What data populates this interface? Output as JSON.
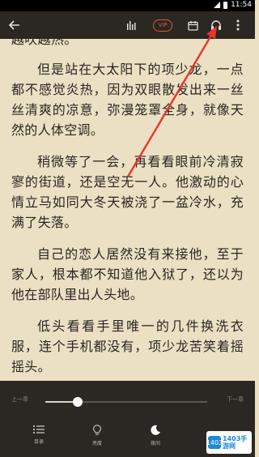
{
  "statusbar": {
    "time": "11:54"
  },
  "toolbar": {
    "back_icon": "arrow-left-icon",
    "chart_icon": "bars-chart-icon",
    "badge_label": "VIP",
    "calendar_icon": "calendar-icon",
    "headphones_icon": "headphones-icon",
    "more_icon": "more-vertical-icon"
  },
  "content": {
    "partial_line": "越吹越热。",
    "paragraphs": [
      "但是站在大太阳下的项少龙，一点都不感觉炎热，因为双眼散发出来一丝丝清爽的凉意，弥漫笼罩全身，就像天然的人体空调。",
      "稍微等了一会，再看看眼前冷清寂寥的街道，还是空无一人。他激动的心情立马如同大冬天被浇了一盆冷水，充满了失落。",
      "自己的恋人居然没有来接他，至于家人，根本都不知道他入狱了，还以为他在部队里出人头地。",
      "低头看看手里唯一的几件换洗衣服，连个手机都没有，项少龙苦笑着摇摇头。"
    ]
  },
  "reader": {
    "prev_chapter": "上一章",
    "next_chapter": "下一章",
    "progress": 0.2
  },
  "actions": {
    "catalog": "目录",
    "light": "亮度",
    "night": "夜间"
  },
  "watermark": {
    "logo_text": "1403",
    "text": "1403手游网"
  },
  "colors": {
    "paper": "#ebe0c4",
    "toolbar": "#2b2723",
    "accent": "#d45a3a",
    "arrow": "#e8362a"
  }
}
